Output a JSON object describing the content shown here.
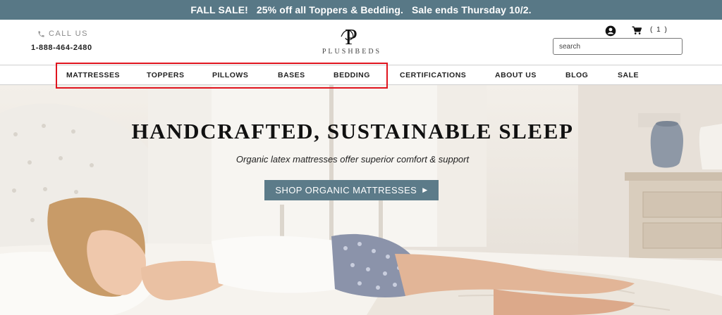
{
  "promo": {
    "text": "FALL SALE!   25% off all Toppers & Bedding.   Sale ends Thursday 10/2."
  },
  "header": {
    "call_label": "CALL US",
    "phone": "1-888-464-2480",
    "logo_text": "PLUSHBEDS",
    "logo_mark": "P",
    "cart_count": "( 1 )",
    "search_placeholder": "search",
    "icons": {
      "phone": "phone-icon",
      "account": "account-icon",
      "cart": "cart-icon"
    }
  },
  "nav": {
    "items": [
      {
        "label": "MATTRESSES"
      },
      {
        "label": "TOPPERS"
      },
      {
        "label": "PILLOWS"
      },
      {
        "label": "BASES"
      },
      {
        "label": "BEDDING"
      },
      {
        "label": "CERTIFICATIONS"
      },
      {
        "label": "ABOUT US"
      },
      {
        "label": "BLOG"
      },
      {
        "label": "SALE"
      }
    ]
  },
  "hero": {
    "title": "HANDCRAFTED, SUSTAINABLE SLEEP",
    "subtitle": "Organic latex mattresses offer superior comfort & support",
    "cta_label": "SHOP ORGANIC MATTRESSES",
    "cta_arrow": "▶"
  },
  "colors": {
    "promo_bar": "#587886",
    "cta_button": "#5c7b89",
    "highlight": "#e0141e"
  }
}
